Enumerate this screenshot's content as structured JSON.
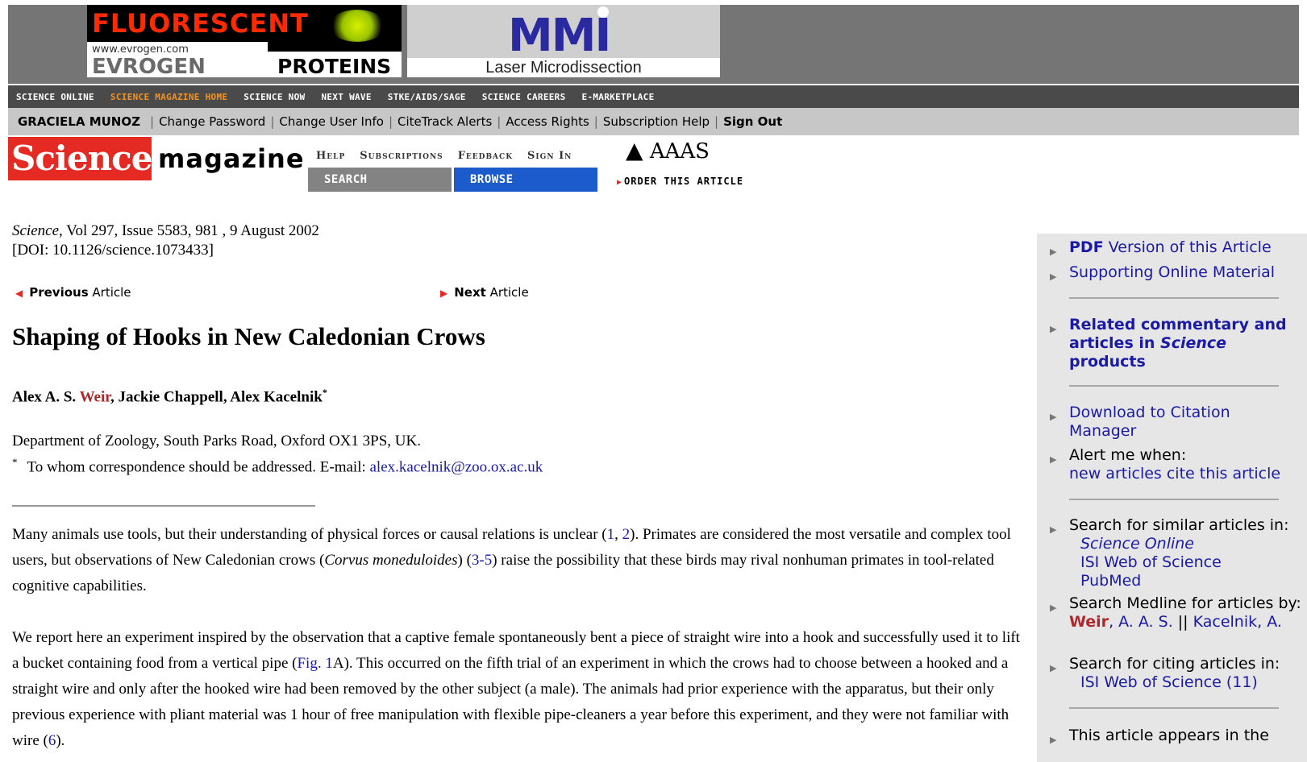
{
  "banner": {
    "ad1": {
      "line1": "FLUORESCENT",
      "url": "www.evrogen.com",
      "brand": "EVROGEN",
      "line2": "PROTEINS"
    },
    "ad2": {
      "brand": "MMI",
      "tagline": "Laser Microdissection"
    }
  },
  "nav": [
    "SCIENCE ONLINE",
    "SCIENCE MAGAZINE HOME",
    "SCIENCE NOW",
    "NEXT WAVE",
    "STKE/AIDS/SAGE",
    "SCIENCE CAREERS",
    "E-MARKETPLACE"
  ],
  "user": {
    "name": "GRACIELA MUNOZ",
    "links": [
      "Change Password",
      "Change User Info",
      "CiteTrack Alerts",
      "Access Rights",
      "Subscription Help"
    ],
    "signout": "Sign Out"
  },
  "header": {
    "logo": "Science",
    "magazine": "magazine",
    "top_links": [
      "Help",
      "Subscriptions",
      "Feedback",
      "Sign In"
    ],
    "aaas": "AAAS",
    "search": "SEARCH",
    "browse": "BROWSE",
    "order": "ORDER THIS ARTICLE"
  },
  "article": {
    "journal": "Science",
    "citation_rest": ", Vol 297, Issue 5583, 981 , 9 August 2002",
    "doi": "[DOI: 10.1126/science.1073433]",
    "prev_bold": "Previous",
    "prev_rest": " Article",
    "next_bold": "Next",
    "next_rest": " Article",
    "title": "Shaping of Hooks in New Caledonian Crows",
    "author1_pre": "Alex A. S. ",
    "author1_hl": "Weir",
    "authors_rest": ", Jackie Chappell, Alex Kacelnik",
    "author_mark": "*",
    "affiliation": "Department of Zoology, South Parks Road, Oxford OX1 3PS, UK.",
    "correspondence_mark": "*",
    "correspondence": "To whom correspondence should be addressed. E-mail: ",
    "email": "alex.kacelnik@zoo.ox.ac.uk",
    "p1": {
      "a": "Many animals use tools, but their understanding of physical forces or causal relations is unclear (",
      "ref1": "1",
      "b": ", ",
      "ref2": "2",
      "c": "). Primates are considered the most versatile and complex tool users, but observations of New Caledonian crows (",
      "species": "Corvus moneduloides",
      "d": ") (",
      "ref3": "3-5",
      "e": ") raise the possibility that these birds may rival nonhuman primates in tool-related cognitive capabilities."
    },
    "p2": {
      "a": "We report here an experiment inspired by the observation that a captive female spontaneously bent a piece of straight wire into a hook and successfully used it to lift a bucket containing food from a vertical pipe (",
      "fig": "Fig. 1",
      "b": "A). This occurred on the fifth trial of an experiment in which the crows had to choose between a hooked and a straight wire and only after the hooked wire had been removed by the other subject (a male). The animals had prior experience with the apparatus, but their only previous experience with pliant material was 1 hour of free manipulation with flexible pipe-cleaners a year before this experiment, and they were not familiar with wire (",
      "ref6": "6",
      "c": ")."
    }
  },
  "sidebar": {
    "pdf_bold": "PDF",
    "pdf_rest": " Version of this Article",
    "som": "Supporting Online Material",
    "related_a": "Related commentary and articles in ",
    "related_b": "Science",
    "related_c": " products",
    "download": "Download to Citation Manager",
    "alert_label": "Alert me when:",
    "alert_link": "new articles cite this article",
    "similar_label": "Search for similar articles in:",
    "similar_1": "Science Online",
    "similar_2": "ISI Web of Science",
    "similar_3": "PubMed",
    "medline_label": "Search Medline for articles by:",
    "medline_hl": "Weir",
    "medline_rest": ", A. A. S.",
    "medline_sep": " || ",
    "medline_2": "Kacelnik, A.",
    "citing_label": "Search for citing articles in:",
    "citing_1": "ISI Web of Science (11)",
    "appears": "This article appears in the"
  },
  "colors": {
    "science_red": "#e52a23",
    "browse_blue": "#1b5bcc",
    "nav_active": "#f7931e",
    "author_red": "#b0262a"
  }
}
